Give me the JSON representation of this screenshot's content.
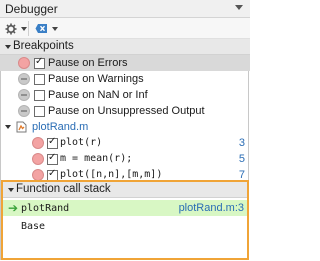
{
  "window": {
    "title": "Debugger"
  },
  "toolbar": {
    "settings_icon": "gear-icon",
    "clear_icon": "clear-breakpoints-icon"
  },
  "breakpoints": {
    "header": "Breakpoints",
    "options": [
      {
        "label": "Pause on Errors",
        "checked": true,
        "enabled": true
      },
      {
        "label": "Pause on Warnings",
        "checked": false,
        "enabled": false
      },
      {
        "label": "Pause on NaN or Inf",
        "checked": false,
        "enabled": false
      },
      {
        "label": "Pause on Unsuppressed Output",
        "checked": false,
        "enabled": false
      }
    ],
    "file": {
      "name": "plotRand.m",
      "lines": [
        {
          "code": "plot(r)",
          "line": "3"
        },
        {
          "code": "m = mean(r);",
          "line": "5"
        },
        {
          "code": "plot([n,n],[m,m])",
          "line": "7"
        }
      ]
    }
  },
  "call_stack": {
    "header": "Function call stack",
    "frames": [
      {
        "name": "plotRand",
        "location": "plotRand.m:3",
        "active": true
      },
      {
        "name": "Base",
        "location": "",
        "active": false
      }
    ]
  }
}
